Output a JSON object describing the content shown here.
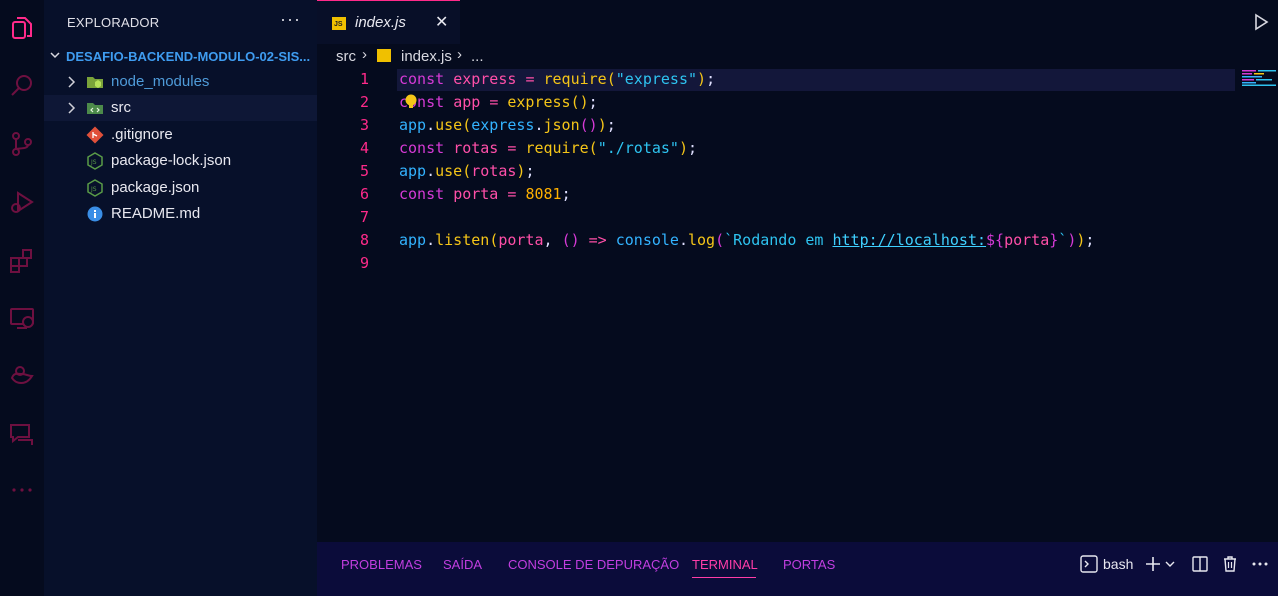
{
  "activity_bar": {
    "icons": [
      "files-icon",
      "search-icon",
      "source-control-icon",
      "run-debug-icon",
      "extensions-icon",
      "remote-explorer-icon",
      "docker-icon",
      "chat-icon",
      "more-icon"
    ]
  },
  "explorer": {
    "title": "EXPLORADOR",
    "more": "···",
    "folder": "DESAFIO-BACKEND-MODULO-02-SIS...",
    "items": [
      {
        "label": "node_modules",
        "type": "folder",
        "color": "#4f9bd9"
      },
      {
        "label": "src",
        "type": "folder",
        "color": "#e8e8f0"
      },
      {
        "label": ".gitignore",
        "type": "git",
        "color": "#e8e8f0"
      },
      {
        "label": "package-lock.json",
        "type": "node",
        "color": "#e8e8f0"
      },
      {
        "label": "package.json",
        "type": "node",
        "color": "#e8e8f0"
      },
      {
        "label": "README.md",
        "type": "info",
        "color": "#e8e8f0"
      }
    ]
  },
  "tab": {
    "icon": "JS",
    "name": "index.js",
    "close": "✕"
  },
  "breadcrumb": {
    "folder": "src",
    "sep1": "›",
    "file": "index.js",
    "sep2": "›",
    "more": "..."
  },
  "editor": {
    "line_numbers": [
      "1",
      "2",
      "3",
      "4",
      "5",
      "6",
      "7",
      "8",
      "9"
    ],
    "current_line": 1
  },
  "panel": {
    "tabs": [
      "PROBLEMAS",
      "SAÍDA",
      "CONSOLE DE DEPURAÇÃO",
      "TERMINAL",
      "PORTAS"
    ],
    "active_tab": "TERMINAL",
    "shell": "bash"
  },
  "colors": {
    "accent": "#ff2a8a",
    "background": "#050b1e",
    "sidebar": "#07102a",
    "panel": "#0b0c3a"
  }
}
